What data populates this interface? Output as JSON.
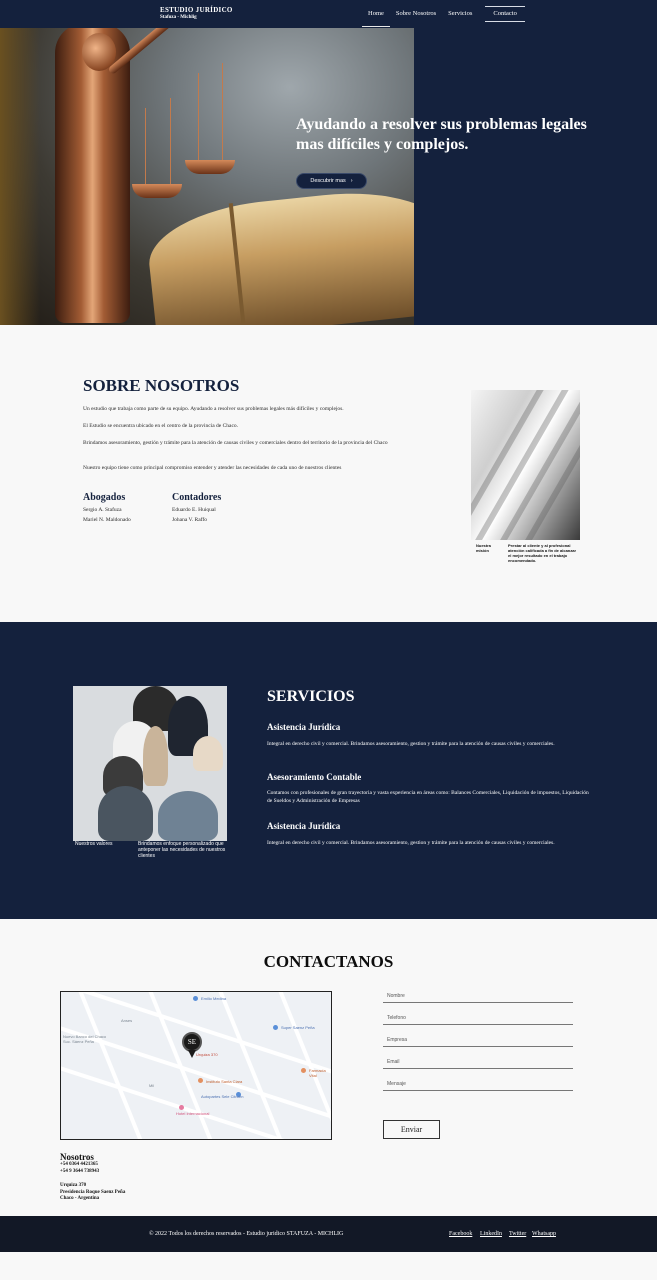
{
  "nav": {
    "brand_title": "ESTUDIO JURÍDICO",
    "brand_sub": "Stafuza - Michlig",
    "links": [
      "Home",
      "Sobre Nosotros",
      "Servicios"
    ],
    "cta": "Contacto"
  },
  "hero": {
    "title": "Ayudando a resolver sus problemas legales mas difíciles y complejos.",
    "button": "Descubrir mas",
    "button_icon": "chevron-right-icon"
  },
  "about": {
    "title": "SOBRE NOSOTROS",
    "paragraphs": [
      "Un estudio que trabaja como parte de su equipo. Ayudando a resolver sus problemas legales más difíciles y complejos.",
      "El Estudio se encuentra ubicado en el centro de la provincia de Chaco.",
      "Brindamos asesoramiento, gestión y trámite para la atención de causas civiles y comerciales dentro del territorio de la provincia del Chaco",
      "Nuestro equipo tiene como principal compromiso entender y atender las necesidades de cada uno de nuestros clientes"
    ],
    "lawyers_title": "Abogados",
    "lawyers": [
      "Sergio A. Stafuza",
      "Mariel N. Maldonado"
    ],
    "accountants_title": "Contadores",
    "accountants": [
      "Eduardo E. Huiqual",
      "Johana V. Raffo"
    ],
    "caption_left": "Nuestra misión",
    "caption_right": "Prestar al cliente y al profesional atención calificada a fin de alcanzar el mejor resultado en el trabajo encomendado."
  },
  "services": {
    "title": "SERVICIOS",
    "caption_left": "Nuestros valores",
    "caption_right": "Brindamos enfoque personalizado que anteponer las necesidades de nuestros clientes",
    "items": [
      {
        "title": "Asistencia Jurídica",
        "desc": "Integral en derecho civil y comercial. Brindamos asesoramiento, gestion y trámite para la atención de causas civiles y comerciales."
      },
      {
        "title": "Asesoramiento Contable",
        "desc": "Contamos con profesionales de gran trayectoria y vasta experiencia en áreas como: Balances Comerciales, Liquidación de impuestos, Liquidación de Sueldos y Administración de Empresas"
      },
      {
        "title": "Asistencia Jurídica",
        "desc": "Integral en derecho civil y comercial. Brindamos asesoramiento, gestion y trámite para la atención de causas civiles y comerciales."
      }
    ]
  },
  "contact": {
    "title": "CONTACTANOS",
    "fields": [
      "Nombre",
      "Telefono",
      "Empresa",
      "Email",
      "Mensaje"
    ],
    "send": "Enviar",
    "addr_title": "Nosotros",
    "phones": [
      "+54 0364 4421365",
      "+54 9 3644 738943"
    ],
    "address": [
      "Urquiza 370",
      "Presidencia Roque Saenz Peña",
      "Chaco - Argentina"
    ],
    "map": {
      "pin_label": "SE",
      "pin_text": "Urquiza 370",
      "places": [
        "Emilio Medina",
        "Super Saenz Peña",
        "Farmacia Vital",
        "Instituto Santa Clara",
        "Autopartes Sele Citroën",
        "Hotel Internacional",
        "Anses",
        "Mil",
        "Nuevo Banco del Chaco Suc. Sáenz Peña"
      ]
    }
  },
  "footer": {
    "copyright": "© 2022 Todos los derechos reservados - Estudio juridico STAFUZA - MICHLIG",
    "social": [
      "Facebook",
      "LinkedIn",
      "Twitter",
      "Whatsapp"
    ]
  }
}
